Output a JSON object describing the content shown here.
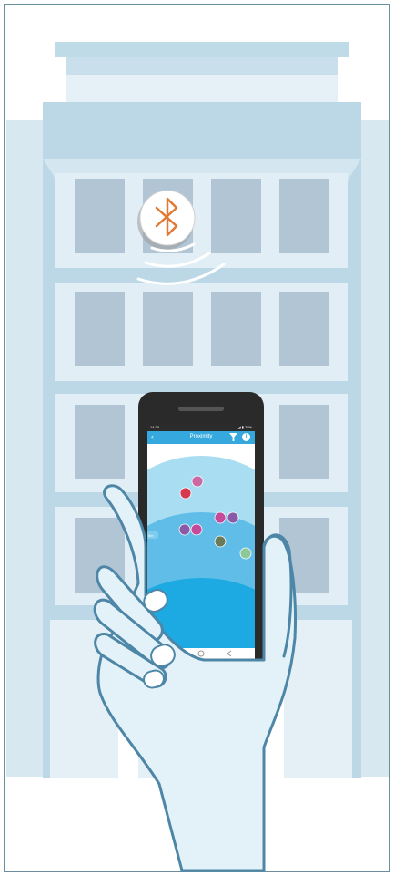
{
  "phone": {
    "status_time": "14:20",
    "status_right": "◢ ▮ 78%",
    "app_title": "Proximity",
    "back_icon": "back-arrow-icon",
    "filter_icon": "filter-icon",
    "info_icon": "info-icon",
    "info_glyph": "i",
    "zone_label": "5m"
  },
  "beacon": {
    "icon": "bluetooth-icon",
    "color": "#e07a34"
  },
  "colors": {
    "sky": "#ffffff",
    "building_light": "#d4e6ef",
    "building_mid": "#bcd8e6",
    "windows": "#b1c5d4",
    "phone_body": "#2a2a2a",
    "app_bar": "#35a9dd",
    "zone_outer": "#a8ddf2",
    "zone_mid": "#5fbde8",
    "zone_inner": "#1da9e1",
    "hand_fill": "#e3f2f9",
    "hand_stroke": "#4d86a6",
    "frame": "#6c8fa0"
  }
}
